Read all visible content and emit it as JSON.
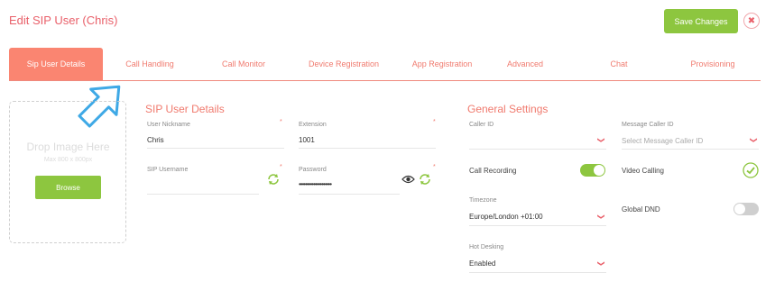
{
  "header": {
    "title": "Edit SIP User (Chris)",
    "save_label": "Save Changes",
    "close_icon": "close-icon"
  },
  "tabs": [
    {
      "label": "Sip User Details",
      "active": true
    },
    {
      "label": "Call Handling"
    },
    {
      "label": "Call Monitor"
    },
    {
      "label": "Device Registration"
    },
    {
      "label": "App Registration"
    },
    {
      "label": "Advanced"
    },
    {
      "label": "Chat"
    },
    {
      "label": "Provisioning"
    }
  ],
  "dropzone": {
    "title": "Drop Image Here",
    "subtitle": "Max 800 x 800px",
    "browse_label": "Browse"
  },
  "sip_details": {
    "heading": "SIP User Details",
    "nickname": {
      "label": "User Nickname",
      "value": "Chris"
    },
    "extension": {
      "label": "Extension",
      "value": "1001"
    },
    "username": {
      "label": "SIP Username",
      "value": ""
    },
    "password": {
      "label": "Password",
      "value": "••••••••••••••••••••"
    },
    "required_mark": "*"
  },
  "general": {
    "heading": "General Settings",
    "caller_id": {
      "label": "Caller ID",
      "value": ""
    },
    "message_caller_id": {
      "label": "Message Caller ID",
      "placeholder": "Select Message Caller ID"
    },
    "call_recording": {
      "label": "Call Recording",
      "enabled": true
    },
    "video_calling": {
      "label": "Video Calling",
      "enabled": true
    },
    "timezone": {
      "label": "Timezone",
      "value": "Europe/London +01:00"
    },
    "global_dnd": {
      "label": "Global DND",
      "enabled": false
    },
    "hot_desking": {
      "label": "Hot Desking",
      "value": "Enabled"
    }
  },
  "colors": {
    "accent": "#f07a6e",
    "green": "#8dc63f",
    "active_tab": "#fa8571"
  }
}
